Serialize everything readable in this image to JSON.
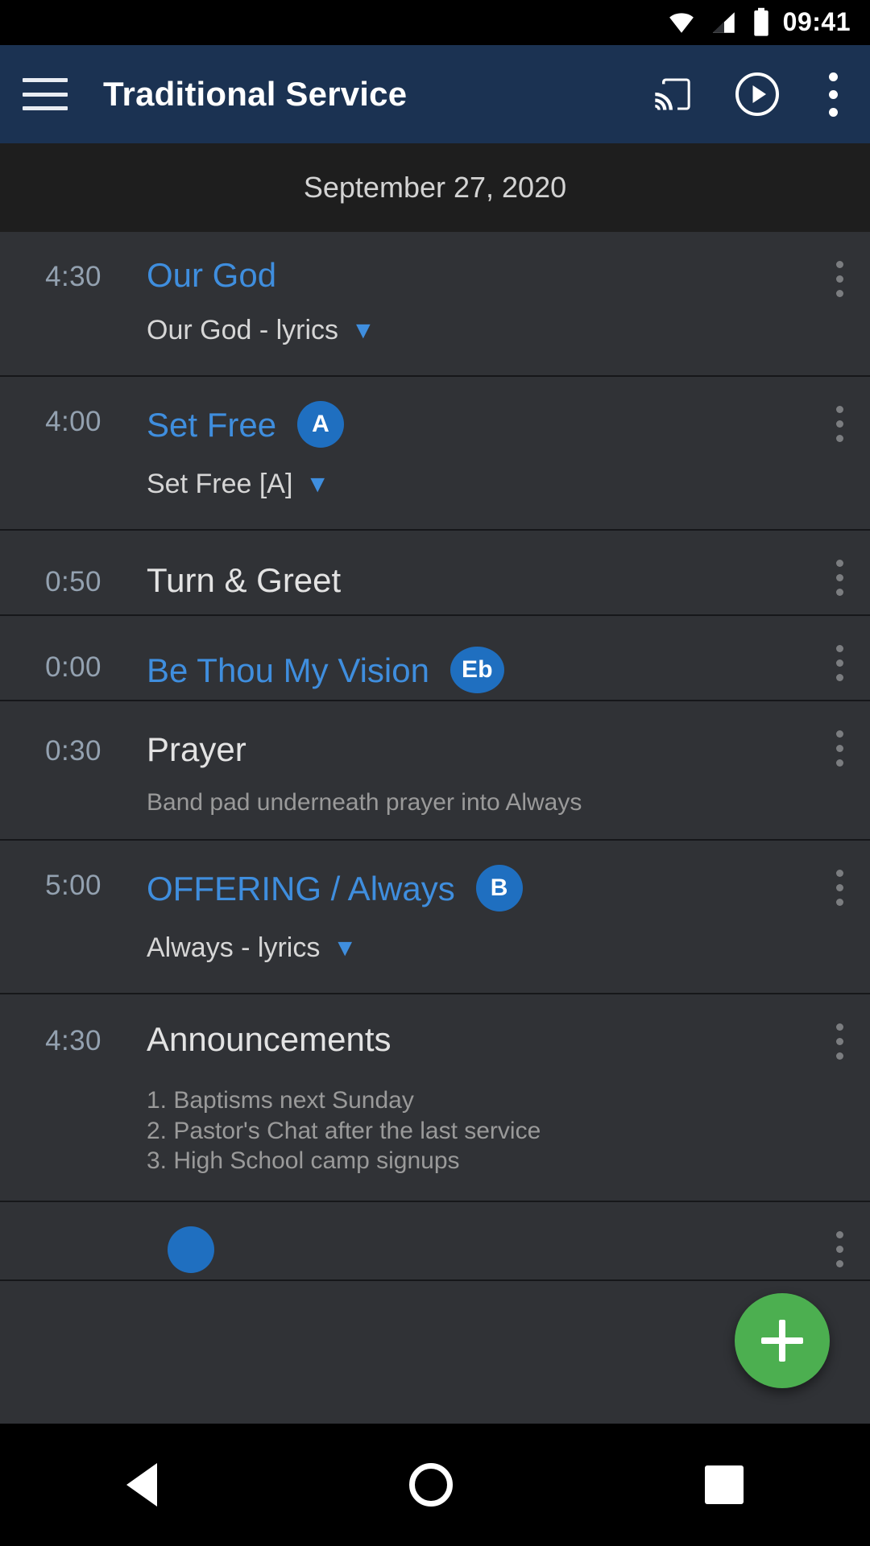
{
  "statusbar": {
    "time": "09:41",
    "icons": [
      "wifi-icon",
      "signal-icon",
      "battery-icon"
    ]
  },
  "appbar": {
    "title": "Traditional Service",
    "menu_icon": "hamburger-icon",
    "cast_icon": "cast-icon",
    "play_icon": "play-circle-icon",
    "overflow_icon": "more-vert-icon",
    "background": "#1b3252"
  },
  "date_header": {
    "date": "September 27, 2020"
  },
  "colors": {
    "song_title": "#3f8ede",
    "badge": "#1f6fc0",
    "fab": "#4caf50",
    "time": "#93a1b0"
  },
  "fab": {
    "label": "+",
    "icon": "add-icon"
  },
  "navbar": {
    "back": "back-icon",
    "home": "home-icon",
    "recents": "recents-icon"
  },
  "items": [
    {
      "time": "4:30",
      "title": "Our God",
      "is_song": true,
      "key": null,
      "attachment": "Our God - lyrics",
      "note": null
    },
    {
      "time": "4:00",
      "title": "Set Free",
      "is_song": true,
      "key": "A",
      "attachment": "Set Free [A]",
      "note": null
    },
    {
      "time": "0:50",
      "title": "Turn & Greet",
      "is_song": false,
      "key": null,
      "attachment": null,
      "note": null
    },
    {
      "time": "0:00",
      "title": "Be Thou My Vision",
      "is_song": true,
      "key": "Eb",
      "attachment": null,
      "note": null
    },
    {
      "time": "0:30",
      "title": "Prayer",
      "is_song": false,
      "key": null,
      "attachment": null,
      "note": "Band pad underneath prayer into Always"
    },
    {
      "time": "5:00",
      "title": "OFFERING / Always",
      "is_song": true,
      "key": "B",
      "attachment": "Always - lyrics",
      "note": null
    },
    {
      "time": "4:30",
      "title": "Announcements",
      "is_song": false,
      "key": null,
      "attachment": null,
      "note_lines": [
        "1. Baptisms next Sunday",
        "2. Pastor's Chat after the last service",
        "3. High School camp signups"
      ]
    }
  ]
}
